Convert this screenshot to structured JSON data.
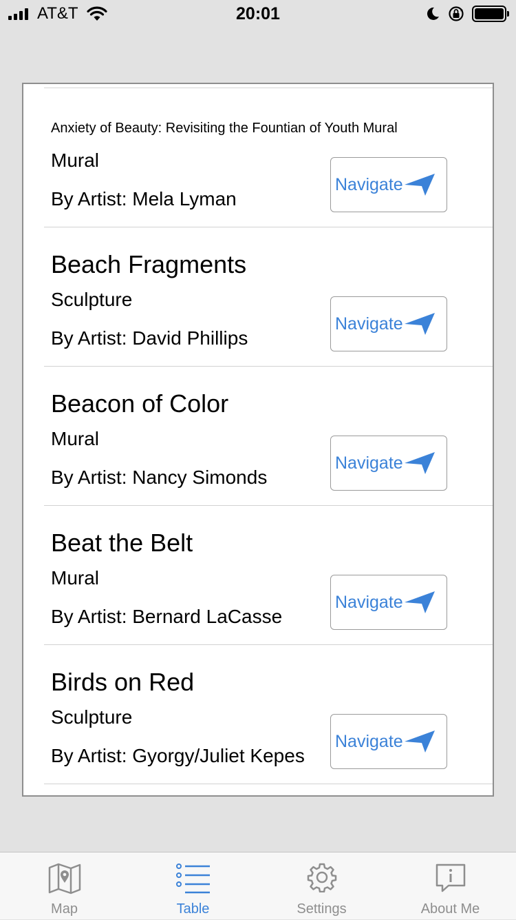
{
  "status_bar": {
    "carrier": "AT&T",
    "time": "20:01"
  },
  "navigate_label": "Navigate",
  "rows": [
    {
      "title": "Anxiety of Beauty: Revisiting the Fountian of Youth Mural",
      "type": "Mural",
      "artist": "By Artist: Mela Lyman"
    },
    {
      "title": "Beach Fragments",
      "type": "Sculpture",
      "artist": "By Artist: David Phillips"
    },
    {
      "title": "Beacon of Color",
      "type": "Mural",
      "artist": "By Artist: Nancy Simonds"
    },
    {
      "title": "Beat the Belt",
      "type": "Mural",
      "artist": "By Artist: Bernard LaCasse"
    },
    {
      "title": "Birds on Red",
      "type": "Sculpture",
      "artist": "By Artist: Gyorgy/Juliet Kepes"
    }
  ],
  "tab_bar": {
    "items": [
      {
        "label": "Map",
        "icon": "map-icon"
      },
      {
        "label": "Table",
        "icon": "list-icon",
        "active": true
      },
      {
        "label": "Settings",
        "icon": "gear-icon"
      },
      {
        "label": "About Me",
        "icon": "info-bubble-icon"
      }
    ]
  },
  "colors": {
    "accent": "#3b82d8",
    "background": "#e2e2e2",
    "inactive_tab": "#8e8e8e"
  }
}
